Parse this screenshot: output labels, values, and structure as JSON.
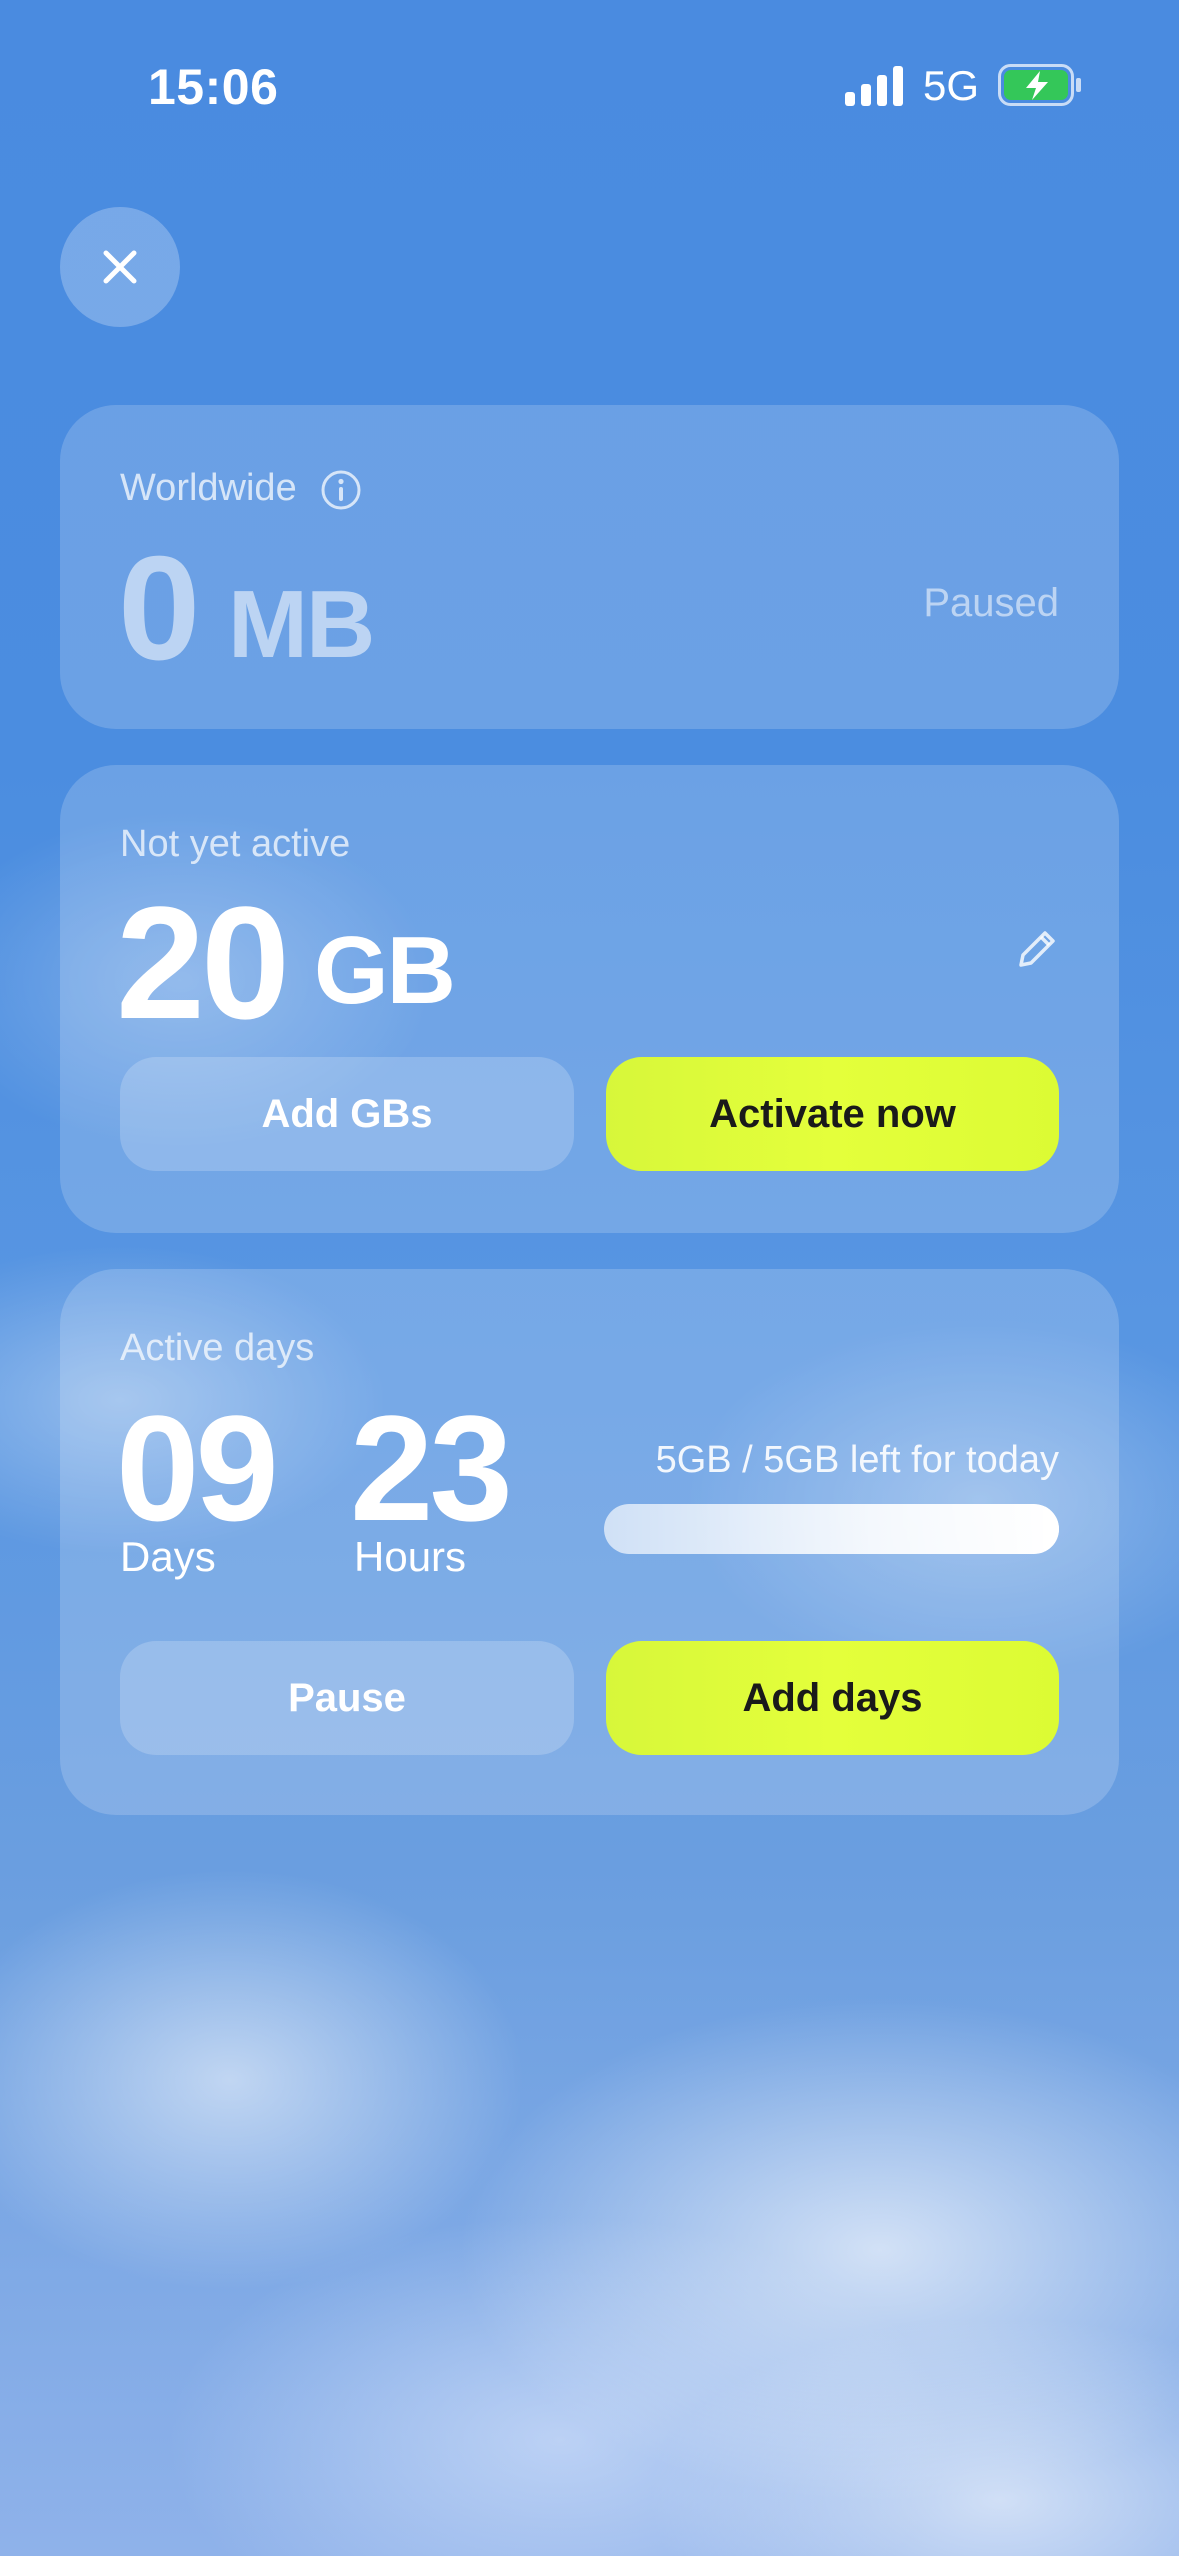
{
  "status_bar": {
    "time": "15:06",
    "network": "5G",
    "signal_icon": "cellular-signal-icon",
    "battery_icon": "battery-charging-icon"
  },
  "close_button": {
    "icon": "close-icon"
  },
  "worldwide": {
    "label": "Worldwide",
    "info_icon": "info-icon",
    "amount": "0",
    "unit": "MB",
    "status": "Paused"
  },
  "data_plan": {
    "label": "Not yet active",
    "amount": "20",
    "unit": "GB",
    "edit_icon": "pencil-icon",
    "add_button": "Add GBs",
    "activate_button": "Activate now"
  },
  "active_days": {
    "label": "Active days",
    "days_value": "09",
    "days_label": "Days",
    "hours_value": "23",
    "hours_label": "Hours",
    "quota_text": "5GB / 5GB left for today",
    "quota_fraction": 1.0,
    "pause_button": "Pause",
    "add_days_button": "Add days"
  },
  "colors": {
    "accent_lime": "#e0fd3a",
    "sky_blue": "#4a8be0"
  }
}
